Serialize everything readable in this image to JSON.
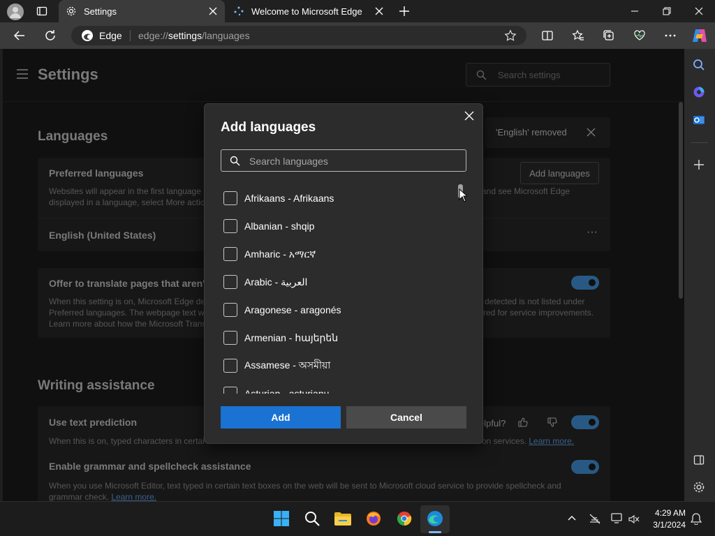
{
  "tabs": [
    {
      "label": "Settings"
    },
    {
      "label": "Welcome to Microsoft Edge"
    }
  ],
  "address": {
    "brand": "Edge",
    "url_prefix": "edge://",
    "url_bold": "settings",
    "url_suffix": "/languages"
  },
  "settings": {
    "title": "Settings",
    "search_placeholder": "Search settings",
    "languages_heading": "Languages",
    "toast": "'English' removed",
    "preferred": {
      "title": "Preferred languages",
      "desc_left_1": "Websites will appear in the first language",
      "desc_left_2": "displayed in a language, select More actio",
      "desc_right_1": "and see Microsoft Edge",
      "add_button": "Add languages",
      "item": "English (United States)",
      "more": "···"
    },
    "translate": {
      "title": "Offer to translate pages that aren't",
      "desc_left_1": "When this setting is on, Microsoft Edge de",
      "desc_left_2": "Preferred languages. The webpage text wi",
      "desc_left_3": "Learn more about how the Microsoft Trans",
      "desc_right_1": "detected is not listed under",
      "desc_right_2": "red for service improvements."
    },
    "writing_heading": "Writing assistance",
    "prediction": {
      "title": "Use text prediction",
      "helpful": "elpful?",
      "desc_left": "When this is on, typed characters in certai",
      "desc_right": "on services.",
      "learn_more": "Learn more."
    },
    "grammar": {
      "title": "Enable grammar and spellcheck assistance",
      "desc_1": "When you use Microsoft Editor, text typed in certain text boxes on the web will be sent to Microsoft cloud service to provide spellcheck and",
      "desc_2": "grammar check.",
      "learn_more": "Learn more."
    }
  },
  "dialog": {
    "title": "Add languages",
    "search_placeholder": "Search languages",
    "languages": [
      "Afrikaans - Afrikaans",
      "Albanian - shqip",
      "Amharic - አማርኛ",
      "Arabic - العربية",
      "Aragonese - aragonés",
      "Armenian - հայերեն",
      "Assamese - অসমীয়া",
      "Asturian - asturianu"
    ],
    "add_label": "Add",
    "cancel_label": "Cancel"
  },
  "taskbar": {
    "time": "4:29 AM",
    "date": "3/1/2024"
  },
  "colors": {
    "accent": "#1a72d2",
    "toggle": "#4aa3f0",
    "link": "#6cb0ff"
  }
}
